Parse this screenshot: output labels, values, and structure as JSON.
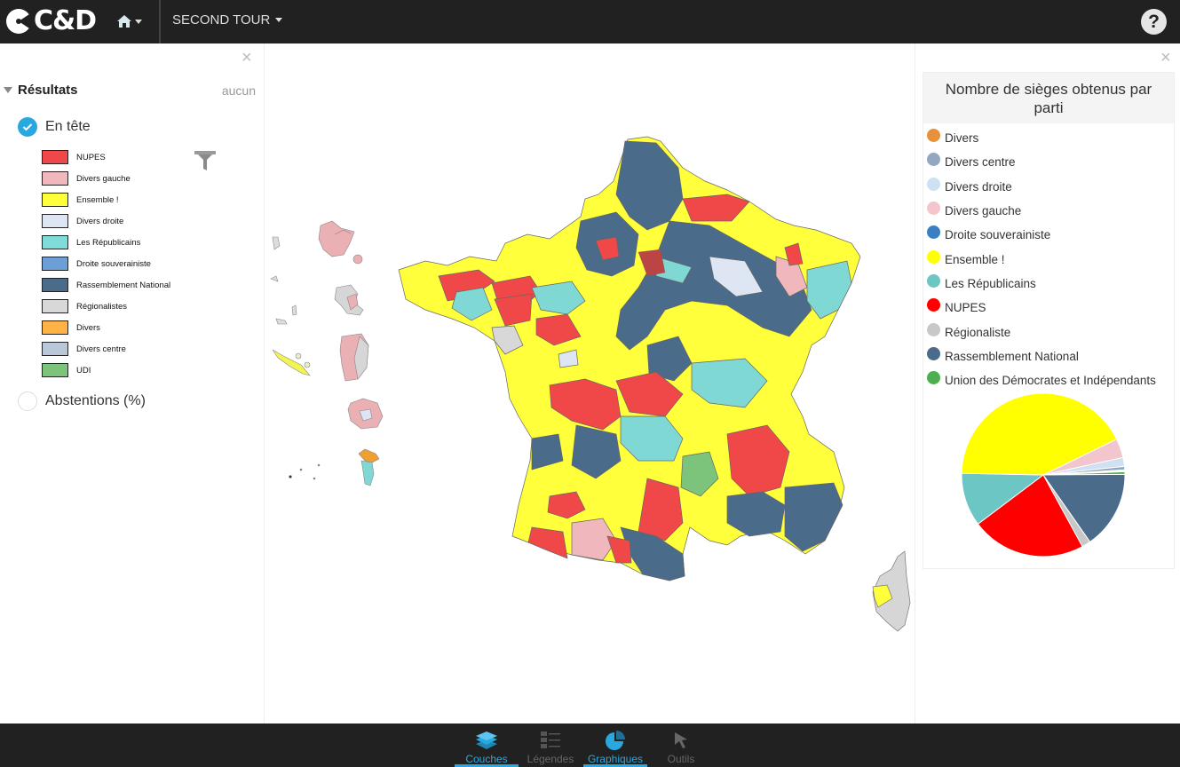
{
  "header": {
    "logo_text": "C&D",
    "home_icon": "home-icon",
    "menu_label": "SECOND TOUR",
    "help_label": "?"
  },
  "left_panel": {
    "close_label": "×",
    "section_title": "Résultats",
    "section_action": "aucun",
    "layers": [
      {
        "label": "En tête",
        "selected": true
      },
      {
        "label": "Abstentions (%)",
        "selected": false
      }
    ],
    "legend": [
      {
        "label": "NUPES",
        "color": "#f04848"
      },
      {
        "label": "Divers gauche",
        "color": "#f0b8bc"
      },
      {
        "label": "Ensemble !",
        "color": "#ffff3c"
      },
      {
        "label": "Divers droite",
        "color": "#dde6f2"
      },
      {
        "label": "Les Républicains",
        "color": "#80dcd8"
      },
      {
        "label": "Droite souverainiste",
        "color": "#6b9fd6"
      },
      {
        "label": "Rassemblement National",
        "color": "#4a6b8a"
      },
      {
        "label": "Régionalistes",
        "color": "#d8d8d8"
      },
      {
        "label": "Divers",
        "color": "#ffb347"
      },
      {
        "label": "Divers centre",
        "color": "#b8c8d8"
      },
      {
        "label": "UDI",
        "color": "#7cc47c"
      }
    ]
  },
  "right_panel": {
    "close_label": "×",
    "chart_title": "Nombre de sièges obtenus par parti"
  },
  "chart_data": {
    "type": "pie",
    "title": "Nombre de sièges obtenus par parti",
    "legend_position": "top",
    "series": [
      {
        "name": "Divers",
        "value": 1,
        "color": "#e8913a"
      },
      {
        "name": "Divers centre",
        "value": 4,
        "color": "#92a8c0"
      },
      {
        "name": "Divers droite",
        "value": 10,
        "color": "#cfe0f0"
      },
      {
        "name": "Divers gauche",
        "value": 22,
        "color": "#f2c6cc"
      },
      {
        "name": "Droite souverainiste",
        "value": 1,
        "color": "#3b7ec2"
      },
      {
        "name": "Ensemble !",
        "value": 245,
        "color": "#ffff00"
      },
      {
        "name": "Les Républicains",
        "value": 61,
        "color": "#6cc6c4"
      },
      {
        "name": "NUPES",
        "value": 131,
        "color": "#ff0000"
      },
      {
        "name": "Régionaliste",
        "value": 10,
        "color": "#c8c8c8"
      },
      {
        "name": "Rassemblement National",
        "value": 89,
        "color": "#4a6b8a"
      },
      {
        "name": "Union des Démocrates et Indépendants",
        "value": 3,
        "color": "#4caf50"
      }
    ],
    "draw_order_clockwise": [
      "Divers gauche",
      "Divers droite",
      "Divers centre",
      "Droite souverainiste",
      "Divers",
      "Union des Démocrates et Indépendants",
      "Rassemblement National",
      "Régionaliste",
      "NUPES",
      "Les Républicains",
      "Ensemble !"
    ]
  },
  "bottom_tabs": [
    {
      "label": "Couches",
      "active": true
    },
    {
      "label": "Légendes",
      "active": false
    },
    {
      "label": "Graphiques",
      "active": true
    },
    {
      "label": "Outils",
      "active": false
    }
  ]
}
